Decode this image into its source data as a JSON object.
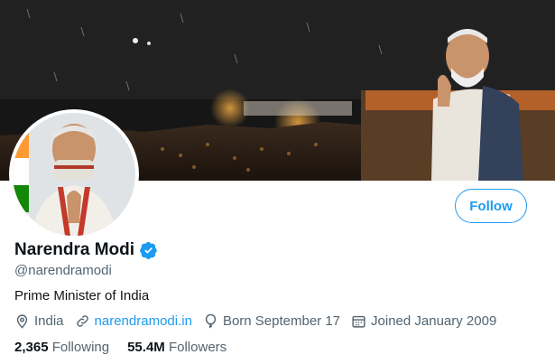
{
  "profile": {
    "name": "Narendra Modi",
    "handle": "@narendramodi",
    "bio": "Prime Minister of India",
    "location": "India",
    "website": "narendramodi.in",
    "born": "Born September 17",
    "joined": "Joined January 2009",
    "following_count": "2,365",
    "following_label": "Following",
    "followers_count": "55.4M",
    "followers_label": "Followers",
    "verified": true
  },
  "actions": {
    "follow_label": "Follow"
  },
  "colors": {
    "accent": "#1d9bf0",
    "text": "#0f1419",
    "muted": "#536471"
  },
  "icons": [
    "location-pin-icon",
    "link-icon",
    "balloon-icon",
    "calendar-icon",
    "verified-badge-icon"
  ]
}
